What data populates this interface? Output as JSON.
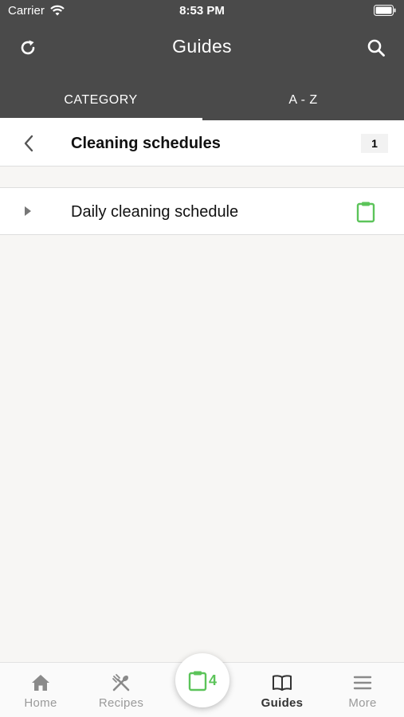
{
  "status_bar": {
    "carrier": "Carrier",
    "time": "8:53 PM"
  },
  "header": {
    "title": "Guides"
  },
  "tabs": [
    {
      "label": "CATEGORY",
      "active": true
    },
    {
      "label": "A - Z",
      "active": false
    }
  ],
  "breadcrumb": {
    "label": "Cleaning schedules",
    "count": "1"
  },
  "items": [
    {
      "label": "Daily cleaning schedule",
      "icon": "clipboard-icon"
    }
  ],
  "fab": {
    "count": "4"
  },
  "bottom_nav": [
    {
      "label": "Home",
      "icon": "home-icon"
    },
    {
      "label": "Recipes",
      "icon": "utensils-icon"
    },
    {
      "label": "Guides",
      "icon": "book-icon",
      "active": true
    },
    {
      "label": "More",
      "icon": "menu-icon"
    }
  ],
  "colors": {
    "header_bg": "#4a4a4a",
    "accent_green": "#5cc45a",
    "page_bg": "#f7f6f4"
  }
}
